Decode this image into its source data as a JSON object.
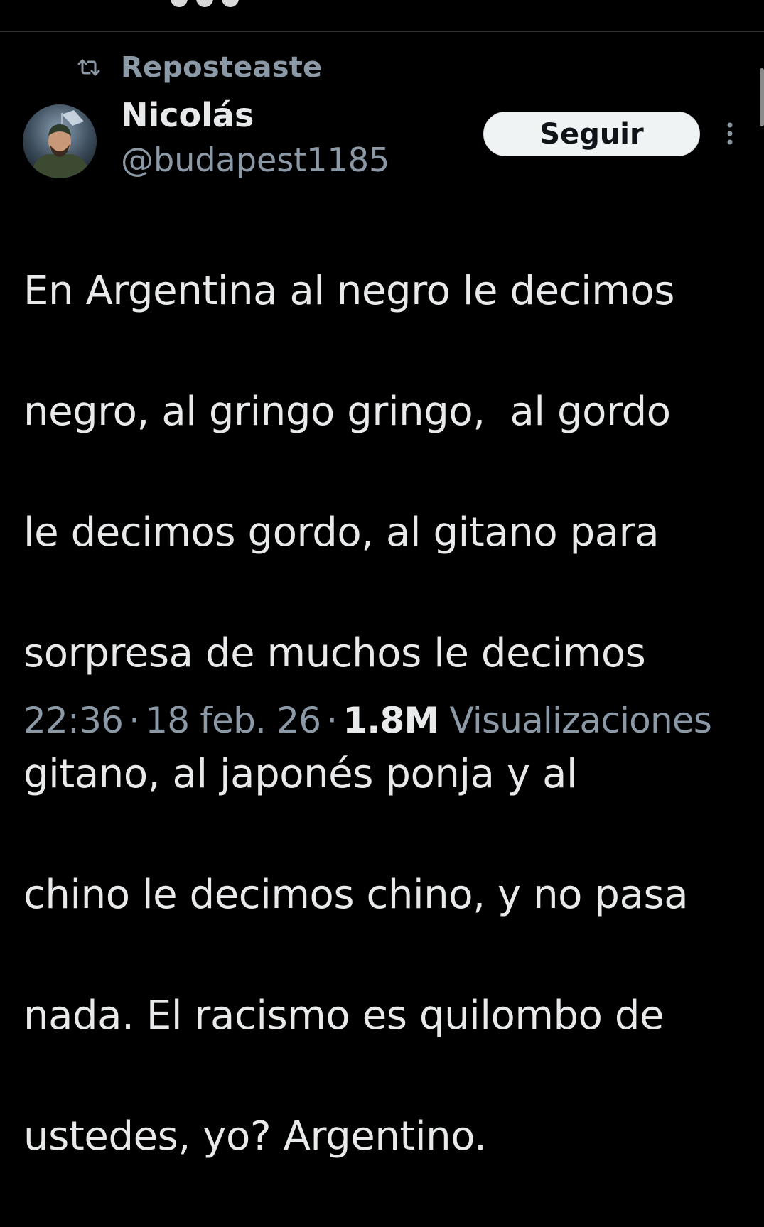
{
  "repost": {
    "icon": "repost-icon",
    "label": "Reposteaste"
  },
  "author": {
    "display_name": "Nicolás",
    "handle": "@budapest1185",
    "avatar": "avatar"
  },
  "actions": {
    "follow_label": "Seguir",
    "more_icon": "more-vertical-icon"
  },
  "tweet": {
    "lines": [
      "En Argentina al negro le decimos",
      "negro, al gringo gringo,  al gordo",
      "le decimos gordo, al gitano para",
      "sorpresa de muchos le decimos",
      "gitano, al japonés ponja y al",
      "chino le decimos chino, y no pasa",
      "nada. El racismo es quilombo de",
      "ustedes, yo? Argentino."
    ]
  },
  "meta": {
    "time": "22:36",
    "date": "18 feb. 26",
    "separator": "·",
    "views_count": "1.8M",
    "views_label": "Visualizaciones"
  },
  "colors": {
    "background": "#000000",
    "primary_text": "#e7e9ea",
    "secondary_text": "#8b98a5",
    "divider": "#2f3336",
    "button_bg": "#eff3f4",
    "button_text": "#0f1419"
  }
}
